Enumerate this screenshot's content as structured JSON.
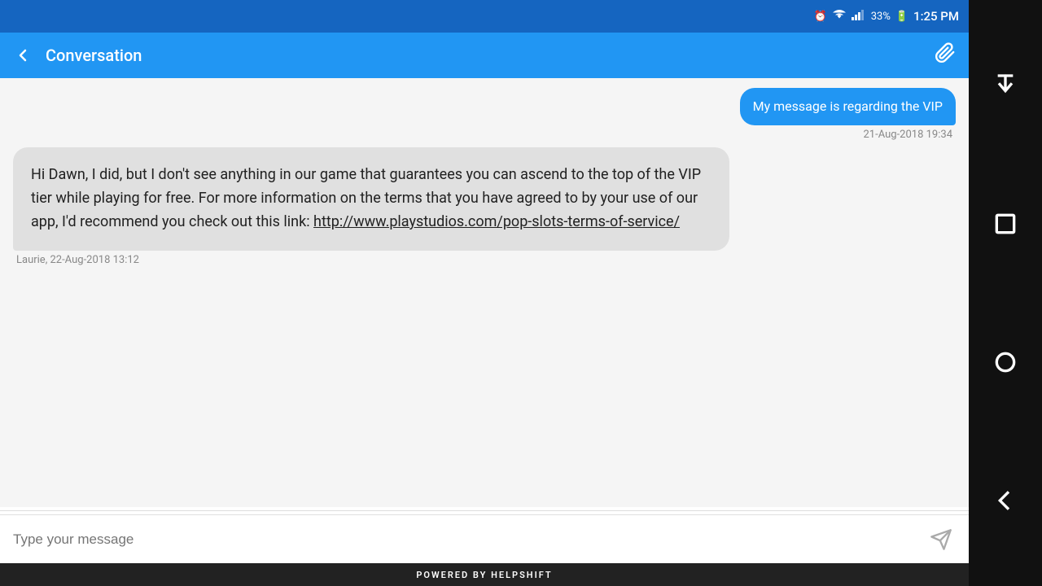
{
  "statusBar": {
    "battery": "33%",
    "time": "1:25 PM"
  },
  "appBar": {
    "title": "Conversation",
    "backLabel": "←",
    "attachIcon": "📎"
  },
  "messages": [
    {
      "type": "outgoing",
      "text": "My message is regarding the VIP",
      "time": "21-Aug-2018 19:34"
    },
    {
      "type": "incoming",
      "text": "Hi Dawn, I did, but I don't see anything in our game that guarantees you can ascend to the top of the VIP tier while playing for free. For more information on the terms that you have agreed to by your use of our app, I'd recommend you check out this link: http://www.playstudios.com/pop-slots-terms-of-service/",
      "linkText": "http://www.playstudios.com/pop-slots-terms-of-service/",
      "sender": "Laurie",
      "time": "22-Aug-2018 13:12",
      "senderTime": "Laurie, 22-Aug-2018 13:12"
    }
  ],
  "input": {
    "placeholder": "Type your message"
  },
  "footer": {
    "text": "POWERED BY HELPSHIFT"
  }
}
